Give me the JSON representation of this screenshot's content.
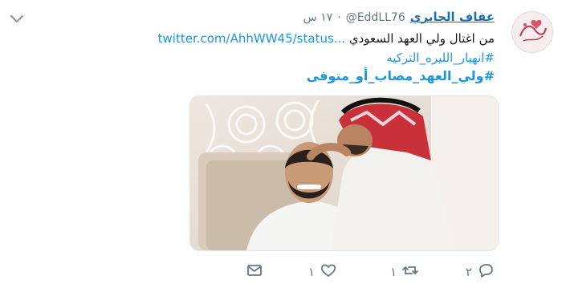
{
  "tweet": {
    "author_name": "عفاف الجابري",
    "handle": "@EddLL76",
    "separator": "·",
    "time": "١٧ س",
    "text": "من اغتال ولي العهد السعودي",
    "link": "twitter.com/AhhWW45/status...",
    "hashtags": [
      "#انهيار_الليره_التركيه",
      "#ولي_العهد_مصاب_أو_متوفى"
    ]
  },
  "actions": {
    "reply_count": "٢",
    "retweet_count": "١",
    "like_count": "١"
  },
  "icons": {
    "menu": "chevron-down-icon",
    "reply": "reply-icon",
    "retweet": "retweet-icon",
    "like": "heart-icon",
    "dm": "envelope-icon"
  },
  "colors": {
    "link": "#1b95e0",
    "name": "#1d6fb0",
    "muted": "#657786"
  }
}
